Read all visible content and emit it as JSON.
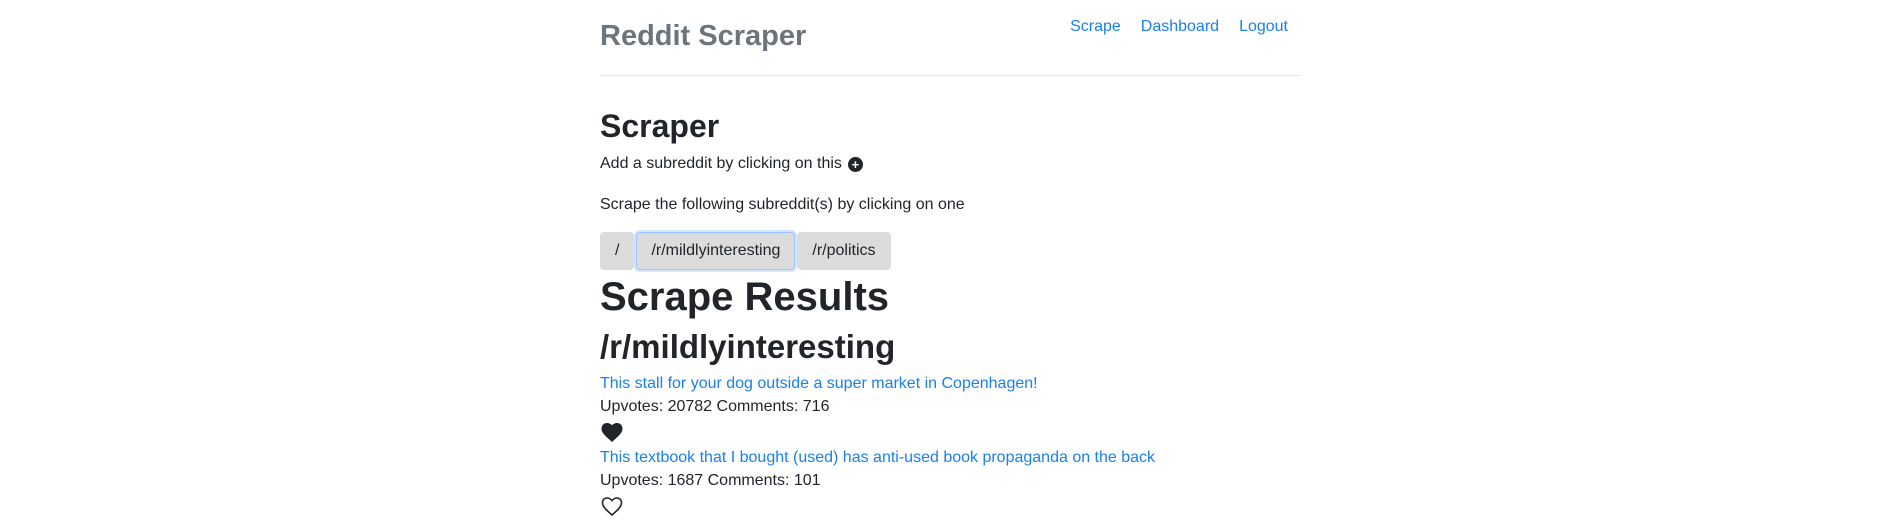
{
  "header": {
    "brand": "Reddit Scraper",
    "nav": [
      {
        "label": "Scrape"
      },
      {
        "label": "Dashboard"
      },
      {
        "label": "Logout"
      }
    ]
  },
  "main": {
    "title": "Scraper",
    "add_text": "Add a subreddit by clicking on this",
    "add_icon": "plus-circle-icon",
    "scrape_text": "Scrape the following subreddit(s) by clicking on one",
    "subreddits": [
      {
        "label": "/",
        "active": false
      },
      {
        "label": "/r/mildlyinteresting",
        "active": true
      },
      {
        "label": "/r/politics",
        "active": false
      }
    ],
    "results_title": "Scrape Results",
    "results_subreddit": "/r/mildlyinteresting",
    "posts": [
      {
        "title": "This stall for your dog outside a super market in Copenhagen!",
        "upvotes": "20782",
        "comments": "716",
        "stats": "Upvotes: 20782 Comments: 716",
        "favorited": true,
        "heart_icon": "heart-filled-icon"
      },
      {
        "title": "This textbook that I bought (used) has anti-used book propaganda on the back",
        "upvotes": "1687",
        "comments": "101",
        "stats": "Upvotes: 1687 Comments: 101",
        "favorited": false,
        "heart_icon": "heart-outline-icon"
      }
    ]
  },
  "colors": {
    "link": "#1a7ff0",
    "brand": "#6c757d",
    "chip_bg": "#dcdcdc",
    "text": "#212529"
  }
}
